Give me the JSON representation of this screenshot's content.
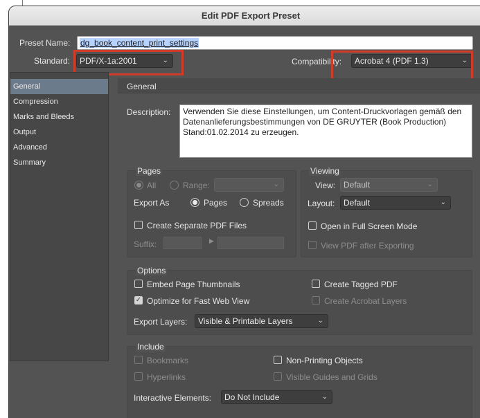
{
  "window": {
    "title": "Edit PDF Export Preset"
  },
  "preset": {
    "label": "Preset Name:",
    "value": "dg_book_content_print_settings"
  },
  "standard": {
    "label": "Standard:",
    "value": "PDF/X-1a:2001"
  },
  "compatibility": {
    "label": "Compatibility:",
    "value": "Acrobat 4 (PDF 1.3)"
  },
  "sidebar": {
    "items": [
      {
        "label": "General"
      },
      {
        "label": "Compression"
      },
      {
        "label": "Marks and Bleeds"
      },
      {
        "label": "Output"
      },
      {
        "label": "Advanced"
      },
      {
        "label": "Summary"
      }
    ]
  },
  "main": {
    "section_title": "General",
    "description": {
      "label": "Description:",
      "text": "Verwenden Sie diese Einstellungen, um Content-Druckvorlagen gemäß den Datenanlieferungsbestimmungen von DE GRUYTER (Book Production) Stand:01.02.2014 zu erzeugen."
    }
  },
  "pages": {
    "title": "Pages",
    "all_label": "All",
    "range_label": "Range:",
    "range_value": "",
    "export_as_label": "Export As",
    "pages_option": "Pages",
    "spreads_option": "Spreads",
    "separate_files_label": "Create Separate PDF Files",
    "suffix_label": "Suffix:"
  },
  "viewing": {
    "title": "Viewing",
    "view_label": "View:",
    "view_value": "Default",
    "layout_label": "Layout:",
    "layout_value": "Default",
    "full_screen_label": "Open in Full Screen Mode",
    "view_after_label": "View PDF after Exporting"
  },
  "options": {
    "title": "Options",
    "embed_thumbnails": "Embed Page Thumbnails",
    "optimize_web": "Optimize for Fast Web View",
    "tagged_pdf": "Create Tagged PDF",
    "acrobat_layers": "Create Acrobat Layers",
    "export_layers_label": "Export Layers:",
    "export_layers_value": "Visible & Printable Layers"
  },
  "include": {
    "title": "Include",
    "bookmarks": "Bookmarks",
    "hyperlinks": "Hyperlinks",
    "non_printing": "Non-Printing Objects",
    "visible_guides": "Visible Guides and Grids",
    "interactive_label": "Interactive Elements:",
    "interactive_value": "Do Not Include"
  },
  "state": {
    "all_selected": true,
    "export_as_selected": "Pages",
    "optimize_web_checked": true
  },
  "colors": {
    "annotation": "#d23a2a",
    "sidebar_active": "#6c7b8c",
    "panel": "#535353"
  },
  "icons": {
    "dropdown": "chevron-down-icon",
    "checkmark": "checkmark-icon"
  }
}
